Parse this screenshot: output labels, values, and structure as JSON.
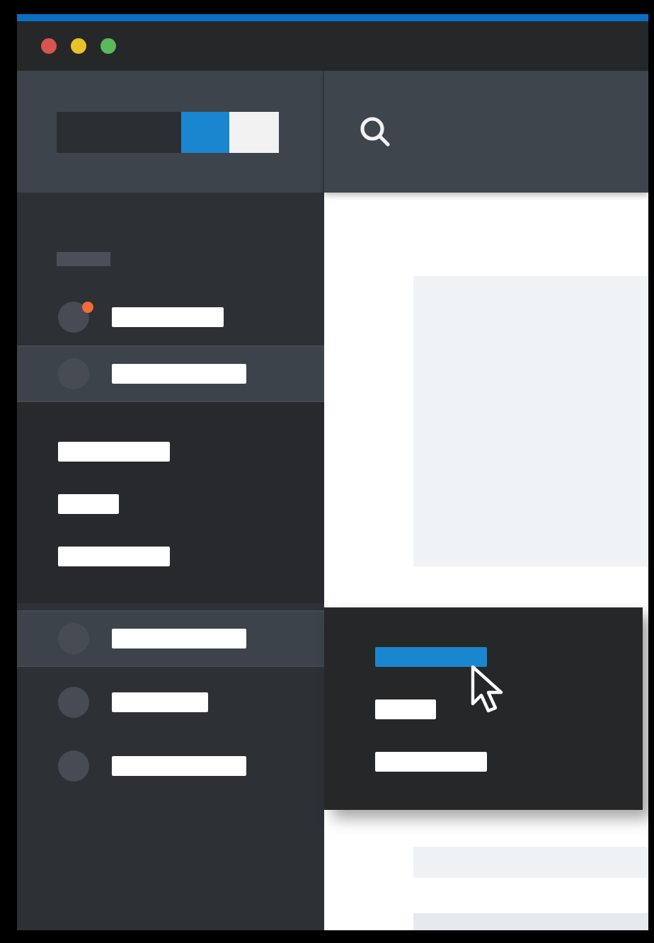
{
  "sidebar": {
    "items": [
      {
        "notification": true,
        "highlighted": false
      },
      {
        "notification": false,
        "highlighted": true,
        "expanded": true,
        "children": [
          {
            "selected": false
          },
          {
            "selected": false
          },
          {
            "selected": false
          }
        ]
      },
      {
        "notification": false,
        "highlighted": true,
        "flyout": [
          {
            "selected": true
          },
          {
            "selected": false
          },
          {
            "selected": false
          }
        ]
      },
      {
        "notification": false,
        "highlighted": false
      },
      {
        "notification": false,
        "highlighted": false
      }
    ]
  }
}
